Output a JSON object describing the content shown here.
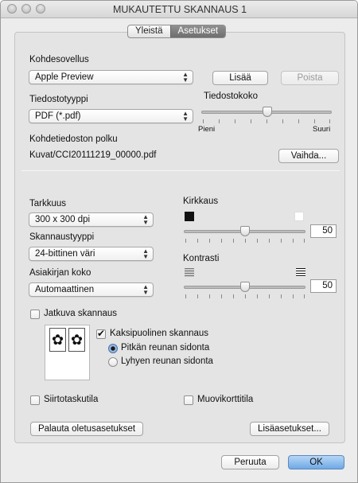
{
  "window": {
    "title": "MUKAUTETTU SKANNAUS 1"
  },
  "tabs": [
    {
      "label": "Yleistä",
      "active": false
    },
    {
      "label": "Asetukset",
      "active": true
    }
  ],
  "target_app": {
    "label": "Kohdesovellus",
    "selected": "Apple Preview",
    "add_button": "Lisää",
    "remove_button": "Poista"
  },
  "file_type": {
    "label": "Tiedostotyyppi",
    "selected": "PDF (*.pdf)"
  },
  "file_size": {
    "label": "Tiedostokoko",
    "min_label": "Pieni",
    "max_label": "Suuri",
    "value_fraction": 0.5
  },
  "target_path": {
    "label": "Kohdetiedoston polku",
    "value": "Kuvat/CCI20111219_00000.pdf",
    "change_button": "Vaihda..."
  },
  "resolution": {
    "label": "Tarkkuus",
    "selected": "300 x 300 dpi"
  },
  "scan_type": {
    "label": "Skannaustyyppi",
    "selected": "24-bittinen väri"
  },
  "doc_size": {
    "label": "Asiakirjan koko",
    "selected": "Automaattinen"
  },
  "brightness": {
    "label": "Kirkkaus",
    "value": "50"
  },
  "contrast": {
    "label": "Kontrasti",
    "value": "50"
  },
  "continuous_scan": {
    "label": "Jatkuva skannaus",
    "checked": false
  },
  "duplex": {
    "label": "Kaksipuolinen skannaus",
    "checked": true,
    "options": [
      {
        "label": "Pitkän reunan sidonta",
        "selected": true
      },
      {
        "label": "Lyhyen reunan sidonta",
        "selected": false
      }
    ]
  },
  "carrier_sheet": {
    "label": "Siirtotaskutila",
    "checked": false
  },
  "plastic_card": {
    "label": "Muovikorttitila",
    "checked": false
  },
  "reset_button": "Palauta oletusasetukset",
  "more_settings_button": "Lisäasetukset...",
  "cancel_button": "Peruuta",
  "ok_button": "OK",
  "colors": {
    "accent": "#6fa9e6",
    "panel": "#e4e4e4",
    "window": "#ececec"
  }
}
